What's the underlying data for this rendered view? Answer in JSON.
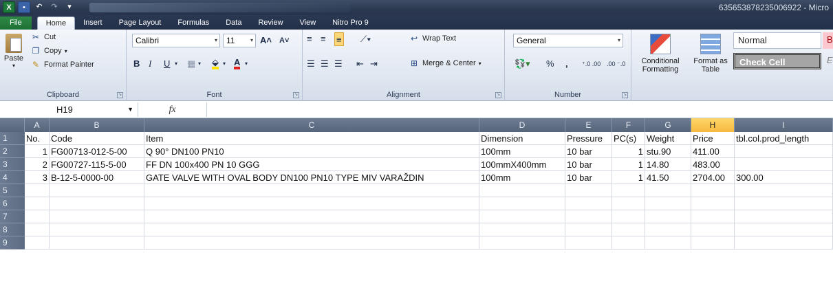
{
  "window": {
    "title": "635653878235006922 - Micro",
    "app_icon": "X"
  },
  "tabs": [
    "File",
    "Home",
    "Insert",
    "Page Layout",
    "Formulas",
    "Data",
    "Review",
    "View",
    "Nitro Pro 9"
  ],
  "ribbon": {
    "clipboard": {
      "label": "Clipboard",
      "paste": "Paste",
      "cut": "Cut",
      "copy": "Copy",
      "format_painter": "Format Painter"
    },
    "font": {
      "label": "Font",
      "name": "Calibri",
      "size": "11",
      "bold": "B",
      "italic": "I",
      "underline": "U"
    },
    "alignment": {
      "label": "Alignment",
      "wrap": "Wrap Text",
      "merge": "Merge & Center"
    },
    "number": {
      "label": "Number",
      "format": "General",
      "percent": "%",
      "comma": ","
    },
    "styles": {
      "conditional": "Conditional Formatting",
      "format_table": "Format as Table",
      "normal": "Normal",
      "check_cell": "Check Cell"
    }
  },
  "formula_bar": {
    "name_box": "H19",
    "fx": "fx",
    "value": ""
  },
  "columns": [
    "A",
    "B",
    "C",
    "D",
    "E",
    "F",
    "G",
    "H",
    "I"
  ],
  "selected_column": "H",
  "rows": [
    [
      "No.",
      "Code",
      "Item",
      "Dimension",
      "Pressure",
      "PC(s)",
      "Weight",
      "Price",
      "tbl.col.prod_length"
    ],
    [
      "1",
      "FG00713-012-5-00",
      "Q 90° DN100 PN10",
      "100mm",
      "10  bar",
      "1",
      "stu.90",
      "411.00",
      ""
    ],
    [
      "2",
      "FG00727-115-5-00",
      "FF DN  100x400 PN 10 GGG",
      "100mmX400mm",
      "10  bar",
      "1",
      "14.80",
      "483.00",
      ""
    ],
    [
      "3",
      "B-12-5-0000-00",
      "GATE VALVE WITH OVAL BODY DN100 PN10 TYPE MIV VARAŽDIN",
      "100mm",
      "10  bar",
      "1",
      "41.50",
      "2704.00",
      "300.00"
    ]
  ],
  "row_numbers": [
    "1",
    "2",
    "3",
    "4",
    "5",
    "6",
    "7",
    "8",
    "9"
  ]
}
